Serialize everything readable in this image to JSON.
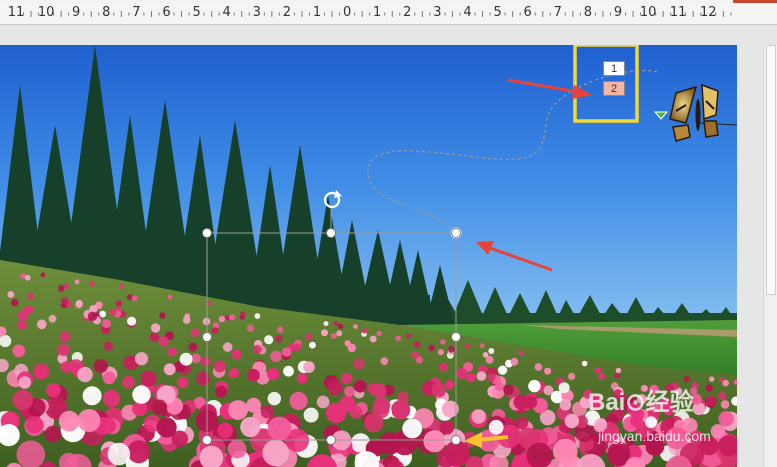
{
  "ruler": {
    "labels": [
      "11",
      "10",
      "9",
      "8",
      "7",
      "6",
      "5",
      "4",
      "3",
      "2",
      "1",
      "0",
      "1",
      "2",
      "3",
      "4",
      "5",
      "6",
      "7",
      "8",
      "9",
      "10",
      "11",
      "12"
    ]
  },
  "animation_tags": {
    "first": "1",
    "second": "2"
  },
  "watermark": {
    "logo_text": "Bai⊙经验",
    "url_text": "jingyan.baidu.com"
  },
  "colors": {
    "highlight_box": "#f5d731",
    "red_arrow": "#e8433a",
    "yellow_arrow": "#f7c22a",
    "selected_tag_fill": "#f5b5a0",
    "path_end_marker": "#e04a3b",
    "path_start_marker": "#3dbb3d"
  },
  "icons": {
    "rotate_handle": "rotate-icon",
    "butterfly": "butterfly-image"
  }
}
